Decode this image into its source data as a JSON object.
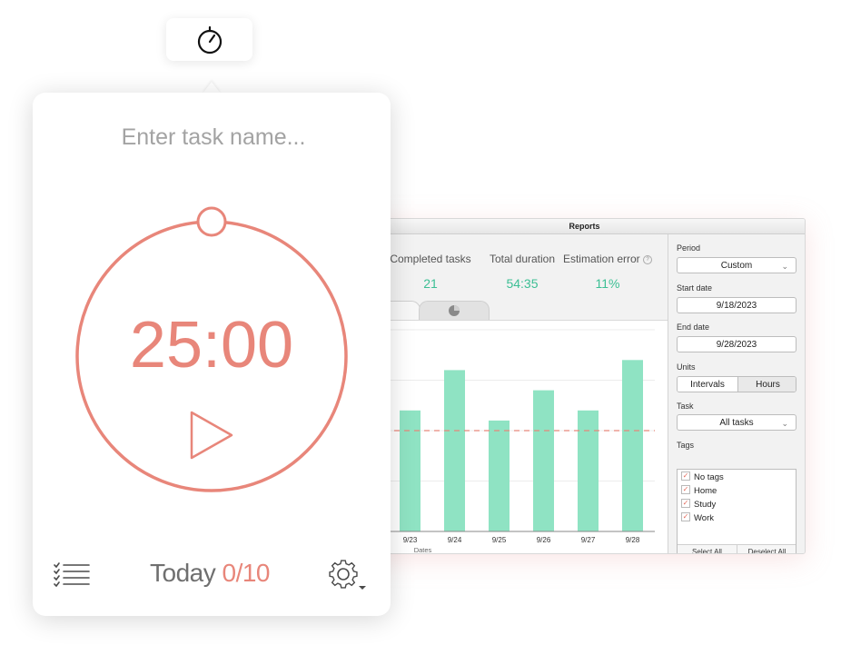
{
  "menubar": {
    "icon": "stopwatch-icon"
  },
  "timer": {
    "task_placeholder": "Enter task name...",
    "time_display": "25:00",
    "accent_color": "#e8867a",
    "play_icon": "play-icon"
  },
  "footer": {
    "list_icon": "task-list-icon",
    "today_label": "Today",
    "today_count": "0/10",
    "settings_icon": "gear-icon"
  },
  "reports": {
    "window_title": "Reports",
    "stats": [
      {
        "label": "Completed tasks",
        "value": "21"
      },
      {
        "label": "Total duration",
        "value": "54:35"
      },
      {
        "label": "Estimation error",
        "value": "11%"
      }
    ],
    "stat_color": "#3cbf94",
    "help_icon": "question-icon",
    "tab_icon": "pie-chart-icon",
    "sidebar": {
      "period_label": "Period",
      "period_value": "Custom",
      "start_label": "Start date",
      "start_value": "9/18/2023",
      "end_label": "End date",
      "end_value": "9/28/2023",
      "units_label": "Units",
      "units_options": [
        "Intervals",
        "Hours"
      ],
      "units_selected": "Intervals",
      "task_label": "Task",
      "task_value": "All tasks",
      "tags_label": "Tags",
      "tags": [
        {
          "name": "No tags",
          "checked": true
        },
        {
          "name": "Home",
          "checked": true
        },
        {
          "name": "Study",
          "checked": true
        },
        {
          "name": "Work",
          "checked": true
        }
      ],
      "select_all": "Select All",
      "deselect_all": "Deselect All"
    }
  },
  "chart_data": {
    "type": "bar",
    "categories": [
      "9/23",
      "9/24",
      "9/25",
      "9/26",
      "9/27",
      "9/28"
    ],
    "values": [
      6,
      8,
      5.5,
      7,
      6,
      8.5
    ],
    "xlabel": "Dates",
    "ylabel": "",
    "ylim": [
      0,
      10
    ],
    "average_line": 5,
    "bar_color": "#8fe3c3",
    "average_color": "#e8867a",
    "grid": true
  }
}
